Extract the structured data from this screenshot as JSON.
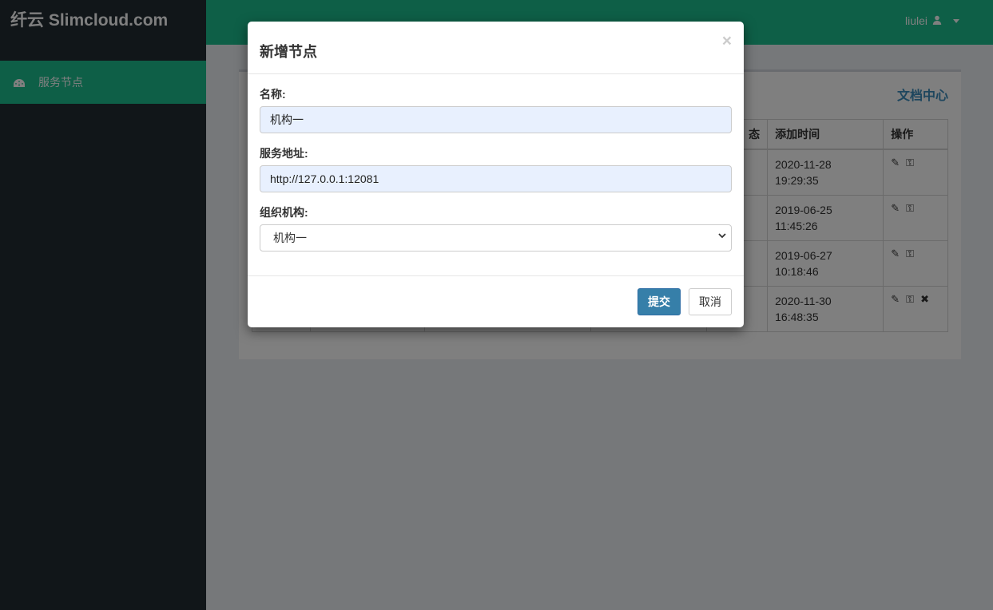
{
  "app": {
    "logo_text": "纤云 Slimcloud.com"
  },
  "sidebar": {
    "items": [
      {
        "label": "服务节点",
        "icon": "dashboard-icon"
      }
    ]
  },
  "header": {
    "username": "liulei",
    "user_icon": "user-icon"
  },
  "main": {
    "doc_link": "文档中心",
    "table": {
      "headers": [
        "",
        "",
        "",
        "",
        "态",
        "添加时间",
        "操作"
      ],
      "rows": [
        {
          "added_date": "2020-11-28",
          "added_time": "19:29:35",
          "ops": [
            "edit-icon",
            "key-icon"
          ]
        },
        {
          "added_date": "2019-06-25",
          "added_time": "11:45:26",
          "ops": [
            "edit-icon",
            "key-icon"
          ]
        },
        {
          "added_date": "2019-06-27",
          "added_time": "10:18:46",
          "ops": [
            "edit-icon",
            "key-icon"
          ]
        },
        {
          "added_date": "2020-11-30",
          "added_time": "16:48:35",
          "ops": [
            "edit-icon",
            "key-icon",
            "delete-icon"
          ]
        }
      ]
    }
  },
  "modal": {
    "title": "新增节点",
    "close_glyph": "×",
    "fields": {
      "name": {
        "label": "名称:",
        "value": "机构一"
      },
      "service_url": {
        "label": "服务地址:",
        "value": "http://127.0.0.1:12081"
      },
      "organization": {
        "label": "组织机构:",
        "selected": "机构一"
      }
    },
    "buttons": {
      "submit": "提交",
      "cancel": "取消"
    }
  },
  "colors": {
    "accent": "#1dbf8f",
    "sidebar_bg": "#222d32",
    "primary_button": "#367fa9",
    "link": "#3c8dbc",
    "autofill_bg": "#e8f0fe"
  }
}
